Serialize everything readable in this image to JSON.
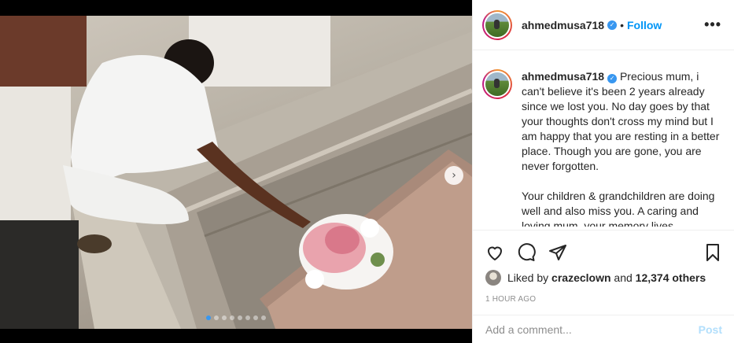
{
  "post": {
    "username": "ahmedmusa718",
    "follow_label": "Follow",
    "separator": "•",
    "more_label": "•••",
    "caption_username": "ahmedmusa718",
    "caption_para1": "Precious mum, i can't believe it's been 2 years already since we lost you. No day goes by that your thoughts don't cross my mind but I am happy that you are resting in a better place. Though you are gone, you are never forgotten.",
    "caption_para2": "Your children & grandchildren are doing well and also miss you. A caring and loving mum, your memory lives",
    "likes_prefix": "Liked by ",
    "likes_user": "crazeclown",
    "likes_and": " and ",
    "likes_count": "12,374 others",
    "timestamp": "1 HOUR AGO",
    "comment_placeholder": "Add a comment...",
    "post_label": "Post"
  },
  "carousel": {
    "next_icon": "›",
    "total_slides": 8,
    "active_index": 0
  },
  "colors": {
    "accent": "#0095f6",
    "verified": "#3897f0",
    "muted": "#8e8e8e",
    "post_disabled": "#b2dffc"
  },
  "icons": [
    "heart-icon",
    "comment-icon",
    "share-icon",
    "bookmark-icon",
    "chevron-right-icon",
    "verified-icon",
    "more-icon"
  ]
}
